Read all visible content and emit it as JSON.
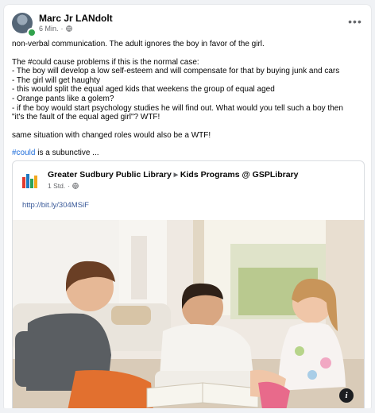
{
  "post": {
    "author": "Marc Jr LANdolt",
    "time": "6 Min.",
    "more": "•••",
    "lines": [
      "non-verbal communication. The adult ignores the boy in favor of the girl.",
      "",
      "The #could cause problems if this is the normal case:",
      "- The boy will develop a low self-esteem and will compensate for that by buying junk and cars",
      "- The girl will get haughty",
      "- this would split the equal aged kids that weekens the group of equal aged",
      "- Orange pants like a golem?",
      "- if the boy would start psychology studies he will find out. What would you tell such a boy then",
      "\"it's the fault of the equal aged girl\"? WTF!",
      "",
      "same situation with changed roles would also be a WTF!",
      ""
    ],
    "hashtag": "#could",
    "see_more_text": " is a subunctive ..."
  },
  "shared": {
    "page_name": "Greater Sudbury Public Library",
    "arrow": "▸",
    "group_name": "Kids Programs @ GSPLibrary",
    "time": "1 Std.",
    "link": "http://bit.ly/304MSiF",
    "info": "i"
  },
  "colors": {
    "link": "#385898",
    "hashtag": "#216fdb",
    "secondary": "#65676b"
  }
}
